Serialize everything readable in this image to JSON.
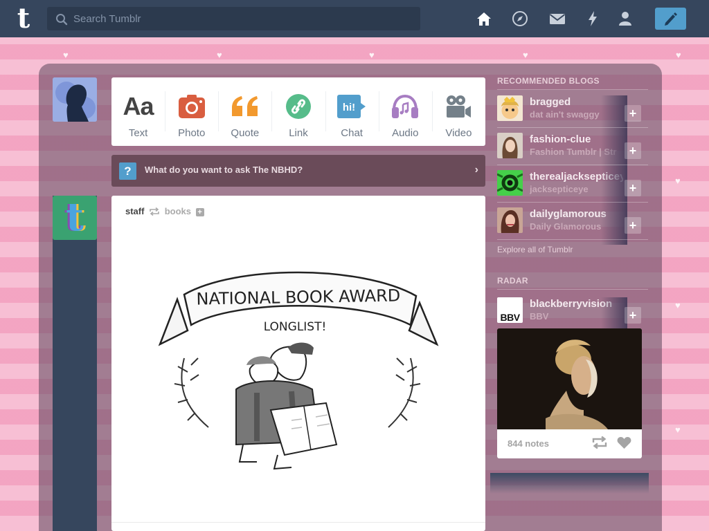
{
  "topbar": {
    "logo": "t",
    "search_placeholder": "Search Tumblr",
    "icons": [
      "home-icon",
      "explore-icon",
      "inbox-icon",
      "activity-icon",
      "account-icon",
      "compose-icon"
    ]
  },
  "post_types": [
    {
      "label": "Text",
      "icon": "text-icon",
      "color": "#444444"
    },
    {
      "label": "Photo",
      "icon": "photo-icon",
      "color": "#d95e40"
    },
    {
      "label": "Quote",
      "icon": "quote-icon",
      "color": "#f2992e"
    },
    {
      "label": "Link",
      "icon": "link-icon",
      "color": "#56bc8a"
    },
    {
      "label": "Chat",
      "icon": "chat-icon",
      "color": "#529ecc"
    },
    {
      "label": "Audio",
      "icon": "audio-icon",
      "color": "#a77dc2"
    },
    {
      "label": "Video",
      "icon": "video-icon",
      "color": "#748089"
    }
  ],
  "ask_bar": {
    "text": "What do you want to ask The NBHD?"
  },
  "post": {
    "author": "staff",
    "reblogged_from": "books",
    "image": {
      "banner": "NATIONAL BOOK AWARD",
      "subtitle": "LONGLIST!"
    }
  },
  "recommended": {
    "heading": "RECOMMENDED BLOGS",
    "blogs": [
      {
        "name": "bragged",
        "subtitle": "dat ain't swaggy"
      },
      {
        "name": "fashion-clue",
        "subtitle": "Fashion Tumblr | Str"
      },
      {
        "name": "therealjacksepticeye",
        "subtitle": "jacksepticeye"
      },
      {
        "name": "dailyglamorous",
        "subtitle": "Daily Glamorous"
      }
    ],
    "explore_link": "Explore all of Tumblr"
  },
  "radar": {
    "heading": "RADAR",
    "blog": {
      "name": "blackberryvision",
      "subtitle": "BBV",
      "avatar_text": "BBV"
    },
    "notes": "844 notes"
  },
  "colors": {
    "nav": "#36465d",
    "accent": "#529ecc",
    "page_bg": "#f4a9c6"
  }
}
